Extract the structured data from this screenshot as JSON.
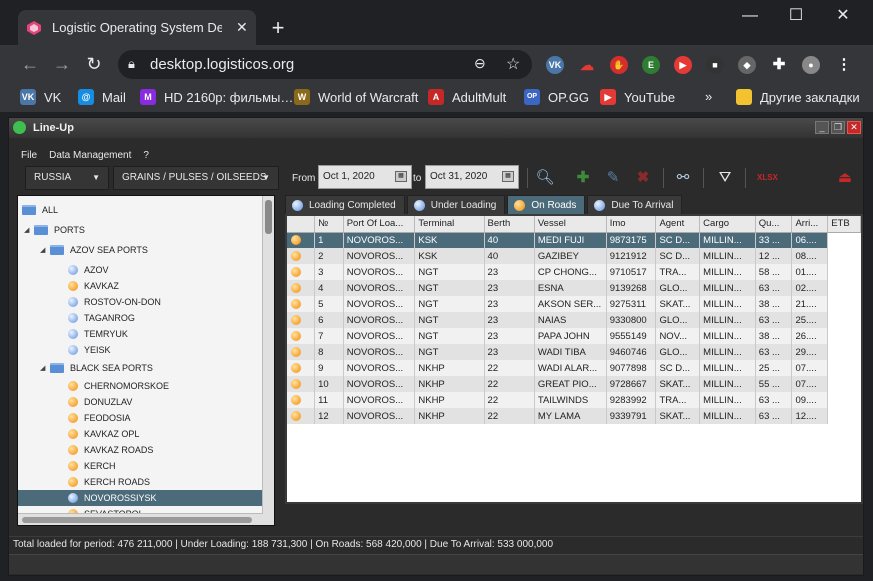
{
  "browser": {
    "tab_title": "Logistic Operating System Desktop",
    "url": "desktop.logisticos.org",
    "bookmarks": [
      {
        "label": "VK",
        "color": "#4a76a8",
        "icon": "VK"
      },
      {
        "label": "Mail",
        "color": "#168de2",
        "icon": "@"
      },
      {
        "label": "HD 2160p: фильмы…",
        "color": "#8a2be2",
        "icon": "M"
      },
      {
        "label": "World of Warcraft",
        "color": "#8a6a1a",
        "icon": "W"
      },
      {
        "label": "AdultMult",
        "color": "#c62828",
        "icon": "A"
      },
      {
        "label": "OP.GG",
        "color": "#3b66c4",
        "icon": "OP"
      },
      {
        "label": "YouTube",
        "color": "#e53935",
        "icon": "▶"
      }
    ],
    "other_bookmarks": "Другие закладки"
  },
  "app": {
    "title": "Line-Up",
    "menu": [
      "File",
      "Data Management",
      "?"
    ],
    "filters": {
      "country": "RUSSIA",
      "cargo_group": "GRAINS / PULSES / OILSEEDS",
      "from_label": "From",
      "from_date": "Oct 1, 2020",
      "to_label": "to",
      "to_date": "Oct 31, 2020"
    },
    "tree": {
      "all": "ALL",
      "ports": "PORTS",
      "azov": "AZOV SEA PORTS",
      "azov_ports": [
        "AZOV",
        "KAVKAZ",
        "ROSTOV-ON-DON",
        "TAGANROG",
        "TEMRYUK",
        "YEISK"
      ],
      "black": "BLACK SEA PORTS",
      "black_ports": [
        "CHERNOMORSKOE",
        "DONUZLAV",
        "FEODOSIA",
        "KAVKAZ OPL",
        "KAVKAZ ROADS",
        "KERCH",
        "KERCH ROADS",
        "NOVOROSSIYSK",
        "SEVASTOPOL"
      ],
      "selected": "NOVOROSSIYSK"
    },
    "tabs": [
      "Loading Completed",
      "Under Loading",
      "On Roads",
      "Due To Arrival"
    ],
    "active_tab": "On Roads",
    "columns": [
      "",
      "№",
      "Port Of Loa...",
      "Terminal",
      "Berth",
      "Vessel",
      "Imo",
      "Agent",
      "Cargo",
      "Qu...",
      "Arri...",
      "ETB"
    ],
    "rows": [
      [
        "1",
        "NOVOROS...",
        "KSK",
        "40",
        "MEDI FUJI",
        "9873175",
        "SC D...",
        "MILLIN...",
        "33 ...",
        "06...."
      ],
      [
        "2",
        "NOVOROS...",
        "KSK",
        "40",
        "GAZIBEY",
        "9121912",
        "SC D...",
        "MILLIN...",
        "12 ...",
        "08...."
      ],
      [
        "3",
        "NOVOROS...",
        "NGT",
        "23",
        "CP CHONG...",
        "9710517",
        "TRA...",
        "MILLIN...",
        "58 ...",
        "01...."
      ],
      [
        "4",
        "NOVOROS...",
        "NGT",
        "23",
        "ESNA",
        "9139268",
        "GLO...",
        "MILLIN...",
        "63 ...",
        "02...."
      ],
      [
        "5",
        "NOVOROS...",
        "NGT",
        "23",
        "AKSON SER...",
        "9275311",
        "SKAT...",
        "MILLIN...",
        "38 ...",
        "21...."
      ],
      [
        "6",
        "NOVOROS...",
        "NGT",
        "23",
        "NAIAS",
        "9330800",
        "GLO...",
        "MILLIN...",
        "63 ...",
        "25...."
      ],
      [
        "7",
        "NOVOROS...",
        "NGT",
        "23",
        "PAPA JOHN",
        "9555149",
        "NOV...",
        "MILLIN...",
        "38 ...",
        "26...."
      ],
      [
        "8",
        "NOVOROS...",
        "NGT",
        "23",
        "WADI TIBA",
        "9460746",
        "GLO...",
        "MILLIN...",
        "63 ...",
        "29...."
      ],
      [
        "9",
        "NOVOROS...",
        "NKHP",
        "22",
        "WADI ALAR...",
        "9077898",
        "SC D...",
        "MILLIN...",
        "25 ...",
        "07...."
      ],
      [
        "10",
        "NOVOROS...",
        "NKHP",
        "22",
        "GREAT PIO...",
        "9728667",
        "SKAT...",
        "MILLIN...",
        "55 ...",
        "07...."
      ],
      [
        "11",
        "NOVOROS...",
        "NKHP",
        "22",
        "TAILWINDS",
        "9283992",
        "TRA...",
        "MILLIN...",
        "63 ...",
        "09...."
      ],
      [
        "12",
        "NOVOROS...",
        "NKHP",
        "22",
        "MY LAMA",
        "9339791",
        "SKAT...",
        "MILLIN...",
        "63 ...",
        "12...."
      ]
    ],
    "status": "Total loaded for period: 476 211,000 | Under Loading: 188 731,300 | On Roads: 568 420,000 | Due To Arrival: 533 000,000"
  }
}
